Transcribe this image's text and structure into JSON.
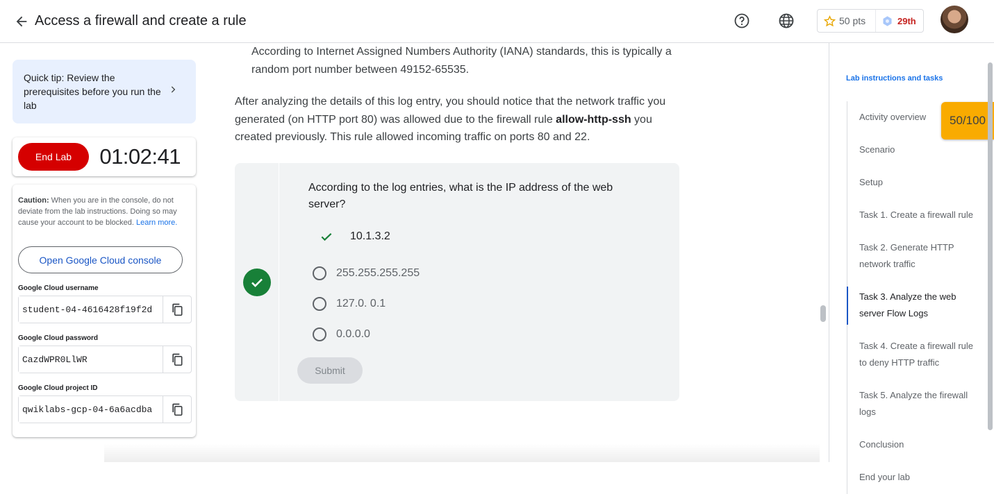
{
  "header": {
    "back_icon": "arrow-left-icon",
    "title": "Access a firewall and create a rule",
    "help_icon": "help-circle-icon",
    "language_icon": "globe-icon",
    "points": "50 pts",
    "points_icon": "star-icon",
    "rank": "29th",
    "rank_icon": "hexagon-badge-icon"
  },
  "tip": {
    "text": "Quick tip: Review the prerequisites before you run the lab",
    "icon": "chevron-right-icon"
  },
  "lab_controls": {
    "end_lab_label": "End Lab",
    "timer": "01:02:41"
  },
  "credentials": {
    "caution_label": "Caution:",
    "caution_text": " When you are in the console, do not deviate from the lab instructions. Doing so may cause your account to be blocked. ",
    "learn_more": "Learn more.",
    "console_button": "Open Google Cloud console",
    "fields": [
      {
        "label": "Google Cloud username",
        "value": "student-04-4616428f19f2d"
      },
      {
        "label": "Google Cloud password",
        "value": "CazdWPR0LlWR"
      },
      {
        "label": "Google Cloud project ID",
        "value": "qwiklabs-gcp-04-6a6acdba"
      }
    ],
    "copy_icon": "copy-icon"
  },
  "content": {
    "para_indent": "According to Internet Assigned Numbers Authority (IANA) standards, this is typically a random port number between 49152-65535.",
    "para_before": "After analyzing the details of this log entry, you should notice that the network traffic you generated (on HTTP port 80) was allowed due to the firewall rule ",
    "para_bold": "allow-http-ssh",
    "para_after": " you created previously. This rule allowed incoming traffic on ports 80 and 22."
  },
  "quiz": {
    "status_icon": "check-circle-icon",
    "question": "According to the log entries, what is the IP address of the web server?",
    "correct_icon": "checkmark-icon",
    "options": [
      "10.1.3.2",
      "255.255.255.255",
      "127.0. 0.1",
      "0.0.0.0"
    ],
    "correct_index": 0,
    "submit_label": "Submit"
  },
  "sidebar": {
    "heading": "Lab instructions and tasks",
    "items": [
      "Activity overview",
      "Scenario",
      "Setup",
      "Task 1. Create a firewall rule",
      "Task 2. Generate HTTP network traffic",
      "Task 3. Analyze the web server Flow Logs",
      "Task 4. Create a firewall rule to deny HTTP traffic",
      "Task 5. Analyze the firewall logs",
      "Conclusion",
      "End your lab"
    ],
    "active_index": 5
  },
  "score": "50/100",
  "colors": {
    "accent": "#1a73e8",
    "end_lab": "#d50000",
    "success": "#188038",
    "score_badge": "#f9ab00",
    "rank": "#c5221f"
  }
}
